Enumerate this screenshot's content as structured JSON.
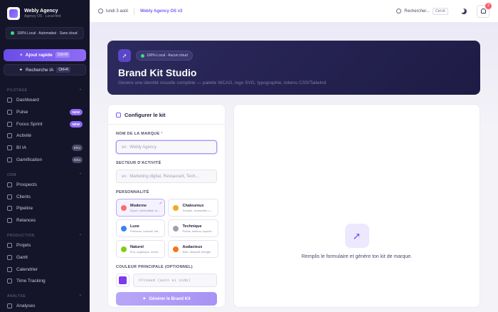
{
  "app": {
    "name": "Webly Agency",
    "subtitle": "Agency OS · Local-first"
  },
  "status": {
    "text": "100% Local · Automatisé · Sans cloud"
  },
  "quick_add": {
    "label": "Ajout rapide",
    "shortcut": "Ctrl+N"
  },
  "ai_search": {
    "label": "Recherche IA",
    "shortcut": "Ctrl+K"
  },
  "nav": {
    "pilotage": {
      "title": "PILOTAGE",
      "items": [
        {
          "label": "Dashboard",
          "badge": ""
        },
        {
          "label": "Pulse",
          "badge": "NEW"
        },
        {
          "label": "Focus Sprint",
          "badge": "NEW"
        },
        {
          "label": "Activité",
          "badge": ""
        },
        {
          "label": "BI IA",
          "badge": "Bêta"
        },
        {
          "label": "Gamification",
          "badge": "Bêta"
        }
      ]
    },
    "crm": {
      "title": "CRM",
      "items": [
        {
          "label": "Prospects"
        },
        {
          "label": "Clients"
        },
        {
          "label": "Pipeline"
        },
        {
          "label": "Relances"
        }
      ]
    },
    "production": {
      "title": "PRODUCTION",
      "items": [
        {
          "label": "Projets"
        },
        {
          "label": "Gantt"
        },
        {
          "label": "Calendrier"
        },
        {
          "label": "Time Tracking"
        }
      ]
    },
    "analyse": {
      "title": "ANALYSE",
      "items": [
        {
          "label": "Analyses"
        }
      ]
    }
  },
  "topbar": {
    "date": "lundi 3 août",
    "crumb": "Webly Agency OS v3",
    "search_label": "Rechercher...",
    "search_shortcut": "Ctrl+K",
    "notif_count": "3"
  },
  "hero": {
    "pill": "100% Local · Aucun cloud",
    "title": "Brand Kit Studio",
    "subtitle": "Génère une identité visuelle complète — palette WCAG, logo SVG, typographie, tokens CSS/Tailwind"
  },
  "form": {
    "title": "Configurer le kit",
    "brand_label": "NOM DE LA MARQUE",
    "brand_required": "*",
    "brand_placeholder": "ex : Webly Agency",
    "sector_label": "SECTEUR D'ACTIVITÉ",
    "sector_placeholder": "ex : Marketing digital, Restaurant, Tech...",
    "personality_label": "PERSONNALITÉ",
    "personalities": [
      {
        "name": "Moderne",
        "desc": "Épuré, minimaliste, te...",
        "color": "#ff6b6b",
        "selected": true
      },
      {
        "name": "Chaleureux",
        "desc": "Humain, accessible, c...",
        "color": "#f5a623",
        "selected": false
      },
      {
        "name": "Luxe",
        "desc": "Premium, exclusif, élé...",
        "color": "#3b82f6",
        "selected": false
      },
      {
        "name": "Technique",
        "desc": "Précis, sérieux, experti...",
        "color": "#9ca3af",
        "selected": false
      },
      {
        "name": "Naturel",
        "desc": "Éco, organique, terroir",
        "color": "#84cc16",
        "selected": false
      },
      {
        "name": "Audacieux",
        "desc": "Bold, disruptif, énergie",
        "color": "#f97316",
        "selected": false
      }
    ],
    "color_label": "COULEUR PRINCIPALE (OPTIONNEL)",
    "color_value": "#7c3aed",
    "color_placeholder": "#7c3aed (auto si vide)",
    "generate_label": "Générer le Brand Kit"
  },
  "preview": {
    "text": "Remplis le formulaire et génère ton kit de marque."
  }
}
